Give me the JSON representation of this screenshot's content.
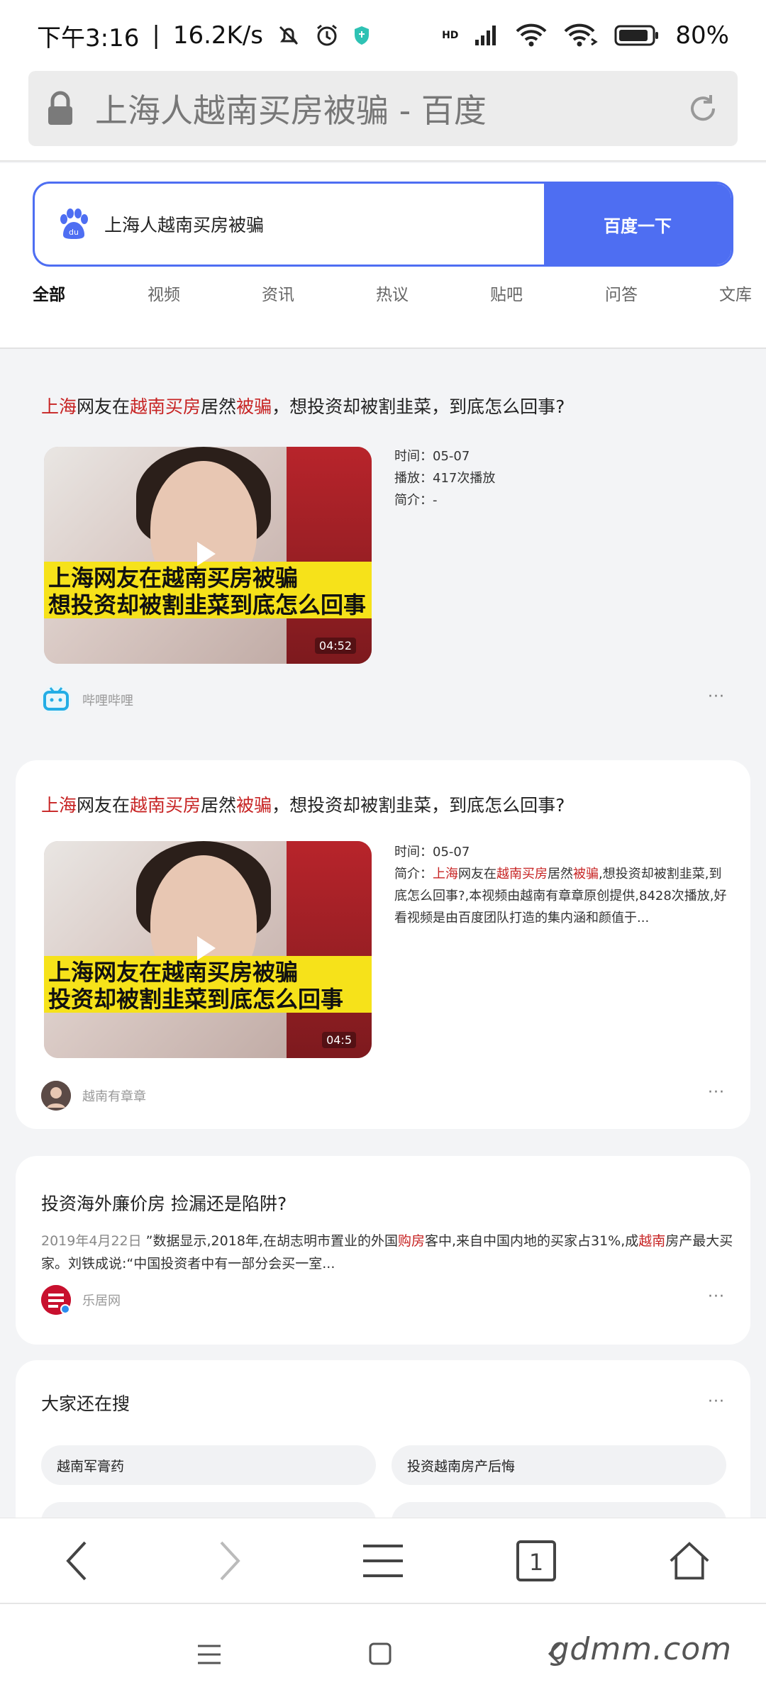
{
  "status": {
    "time": "下午3:16",
    "speed": "16.2K/s",
    "network": "HD",
    "battery": "80%"
  },
  "urlbar": {
    "title": "上海人越南买房被骗 - 百度"
  },
  "search": {
    "query": "上海人越南买房被骗",
    "button": "百度一下",
    "logo": "du"
  },
  "tabs": [
    "全部",
    "视频",
    "资讯",
    "热议",
    "贴吧",
    "问答",
    "文库"
  ],
  "results": [
    {
      "title_parts": [
        {
          "text": "上海",
          "hl": true
        },
        {
          "text": "网友在",
          "hl": false
        },
        {
          "text": "越南买房",
          "hl": true
        },
        {
          "text": "居然",
          "hl": false
        },
        {
          "text": "被骗",
          "hl": true
        },
        {
          "text": "，想投资却被割韭菜，到底怎么回事?",
          "hl": false
        }
      ],
      "thumb_caption_1": "上海网友在越南买房被骗",
      "thumb_caption_2": "想投资却被割韭菜到底怎么回事",
      "duration": "04:52",
      "meta": [
        "时间：05-07",
        "播放：417次播放",
        "简介：-"
      ],
      "source": "哔哩哔哩"
    },
    {
      "title_parts": [
        {
          "text": "上海",
          "hl": true
        },
        {
          "text": "网友在",
          "hl": false
        },
        {
          "text": "越南买房",
          "hl": true
        },
        {
          "text": "居然",
          "hl": false
        },
        {
          "text": "被骗",
          "hl": true
        },
        {
          "text": "，想投资却被割韭菜，到底怎么回事?",
          "hl": false
        }
      ],
      "thumb_caption_1": "上海网友在越南买房被骗",
      "thumb_caption_2": "投资却被割韭菜到底怎么回事",
      "duration": "04:5",
      "meta_time": "时间：05-07",
      "desc_parts": [
        {
          "text": "简介：",
          "hl": false
        },
        {
          "text": "上海",
          "hl": true
        },
        {
          "text": "网友在",
          "hl": false
        },
        {
          "text": "越南买房",
          "hl": true
        },
        {
          "text": "居然",
          "hl": false
        },
        {
          "text": "被骗",
          "hl": true
        },
        {
          "text": ",想投资却被割韭菜,到底怎么回事?,本视频由越南有章章原创提供,8428次播放,好看视频是由百度团队打造的集内涵和颜值于...",
          "hl": false
        }
      ],
      "source": "越南有章章"
    },
    {
      "title": "投资海外廉价房 捡漏还是陷阱?",
      "desc_date": "2019年4月22日",
      "desc_parts": [
        {
          "text": " ”数据显示,2018年,在胡志明市置业的外国",
          "hl": false
        },
        {
          "text": "购房",
          "hl": true
        },
        {
          "text": "客中,来自中国内地的买家占31%,成",
          "hl": false
        },
        {
          "text": "越南",
          "hl": true
        },
        {
          "text": "房产最大买家。刘铁成说:“中国投资者中有一部分会买一室...",
          "hl": false
        }
      ],
      "source": "乐居网"
    }
  ],
  "related": {
    "title": "大家还在搜",
    "items": [
      "越南军膏药",
      "投资越南房产后悔"
    ]
  },
  "more": "···",
  "watermark": "gdmm.com",
  "nav": {
    "tab_count": "1"
  }
}
